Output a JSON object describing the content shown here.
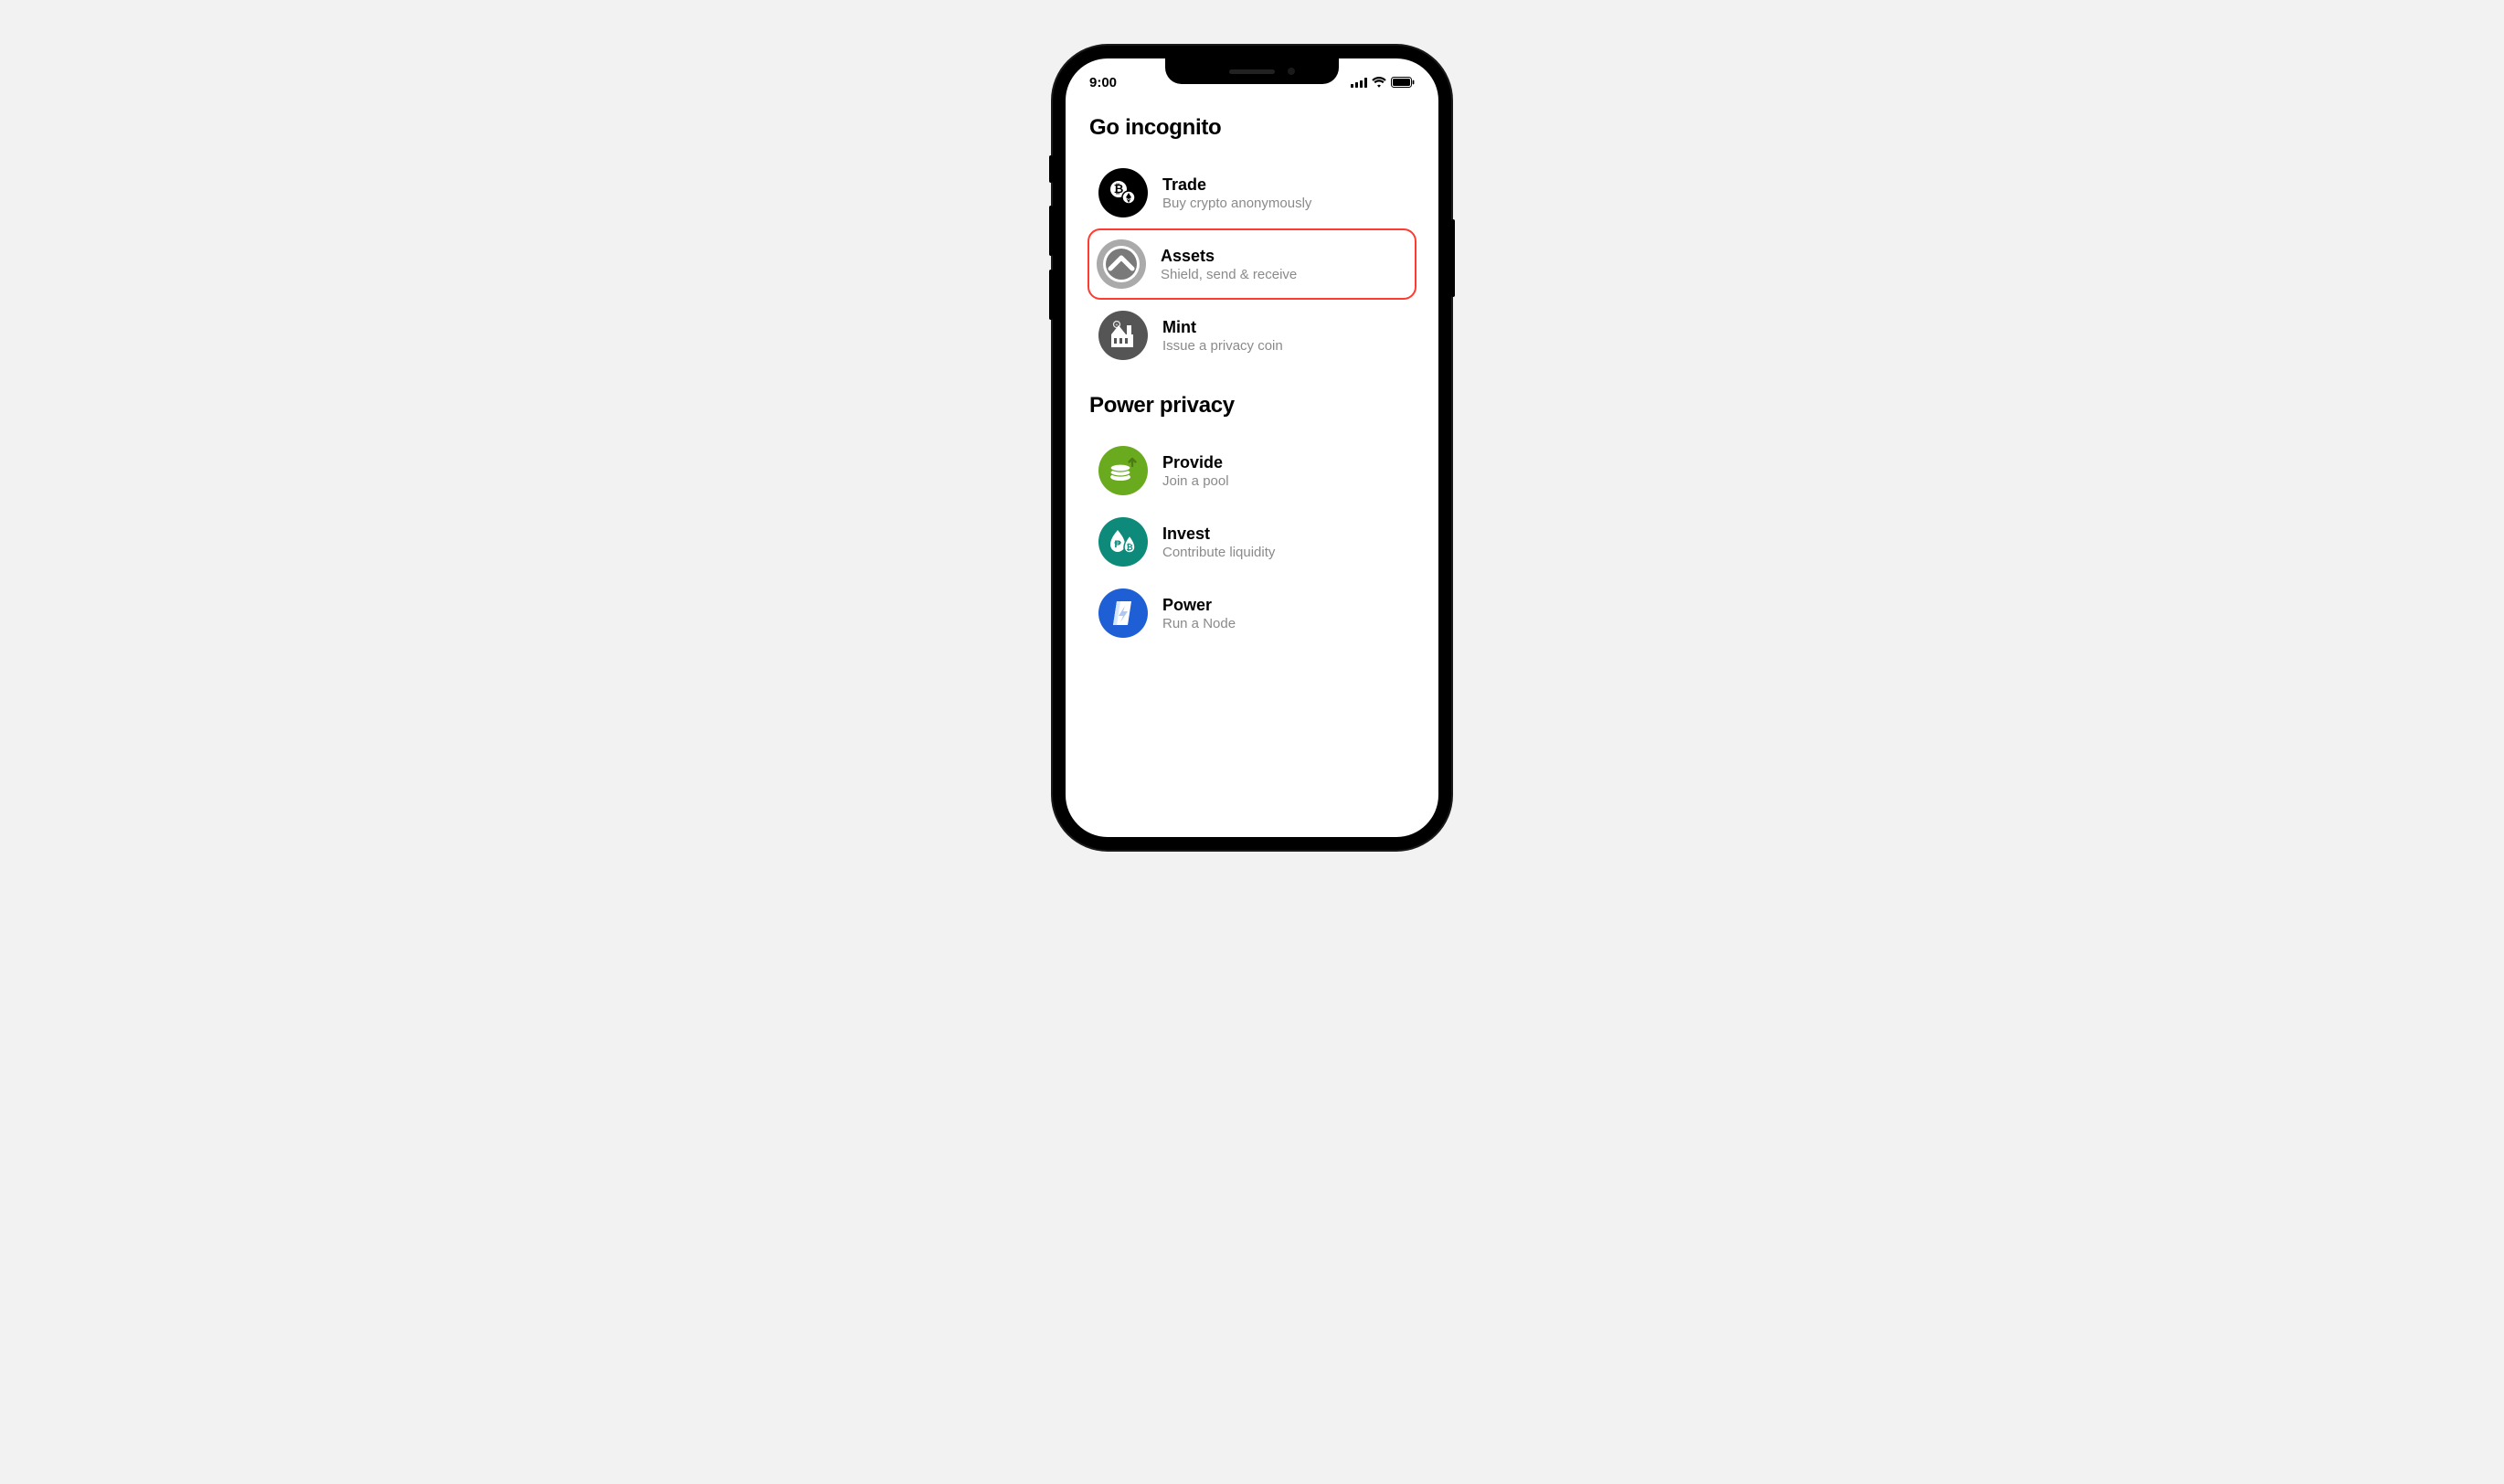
{
  "status_bar": {
    "time": "9:00"
  },
  "sections": {
    "s1": {
      "title": "Go incognito",
      "items": {
        "trade": {
          "title": "Trade",
          "subtitle": "Buy crypto anonymously"
        },
        "assets": {
          "title": "Assets",
          "subtitle": "Shield, send & receive"
        },
        "mint": {
          "title": "Mint",
          "subtitle": "Issue a privacy coin"
        }
      }
    },
    "s2": {
      "title": "Power privacy",
      "items": {
        "provide": {
          "title": "Provide",
          "subtitle": "Join a pool"
        },
        "invest": {
          "title": "Invest",
          "subtitle": "Contribute liquidity"
        },
        "power": {
          "title": "Power",
          "subtitle": "Run a Node"
        }
      }
    }
  },
  "highlighted_item": "assets"
}
